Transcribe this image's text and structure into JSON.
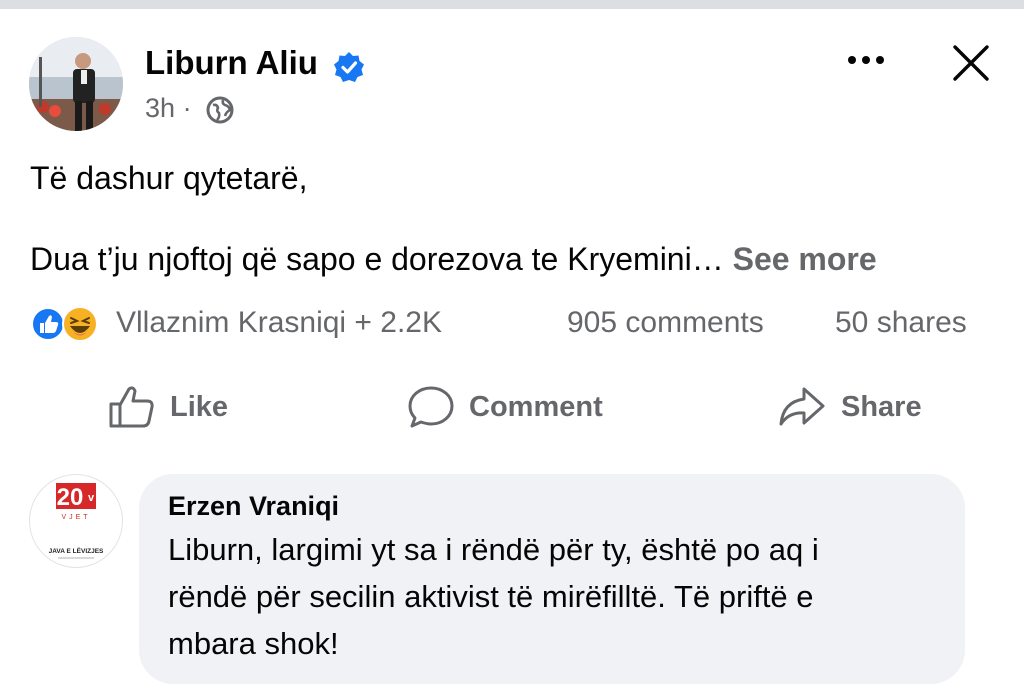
{
  "post": {
    "author": "Liburn Aliu",
    "time": "3h",
    "separator": "·",
    "body_line1": "Të dashur qytetarë,",
    "body_line2": "Dua t’ju njoftoj që sapo e dorezova te Kryemini…",
    "see_more": "See more",
    "icons": {
      "verified": "verified-badge-icon",
      "privacy": "globe-icon",
      "more": "more-options-icon",
      "close": "close-icon"
    }
  },
  "stats": {
    "reactions_text": "Vllaznim Krasniqi + 2.2K",
    "comments": "905 comments",
    "shares": "50 shares",
    "reaction_icons": [
      "like-reaction-icon",
      "haha-reaction-icon"
    ]
  },
  "actions": {
    "like": "Like",
    "comment": "Comment",
    "share": "Share"
  },
  "comment": {
    "author": "Erzen Vraniqi",
    "line1": "Liburn, largimi yt sa i rëndë për ty, është po aq i",
    "line2": "rëndë për secilin aktivist të mirëfilltë. Të priftë e",
    "line3": "mbara shok!",
    "avatar_logo_top": "20",
    "avatar_logo_sub": "VJET",
    "avatar_logo_bottom": "JAVA E LËVIZJES"
  },
  "colors": {
    "text": "#050505",
    "secondary": "#65676b",
    "verified": "#1877f2",
    "bubble": "#f0f2f5",
    "logo_red": "#d62828"
  }
}
